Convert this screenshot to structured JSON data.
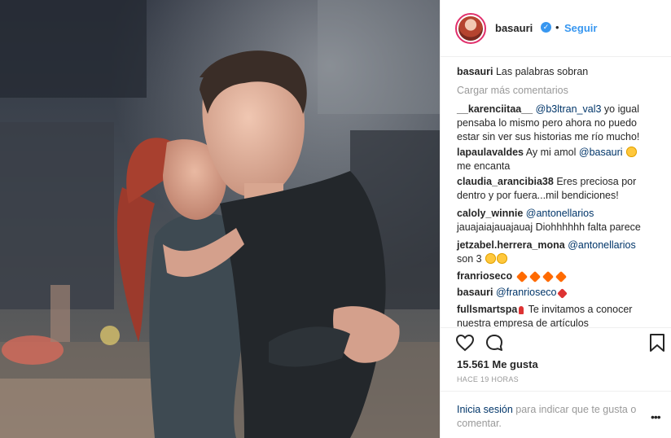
{
  "header": {
    "username": "basauri",
    "dot": "•",
    "follow_label": "Seguir",
    "avatar_icon": "profile-avatar",
    "verified_icon": "verified-badge-icon"
  },
  "caption": {
    "username": "basauri",
    "text": "Las palabras sobran"
  },
  "load_more": "Cargar más comentarios",
  "comments": [
    {
      "user": "__karenciitaa__",
      "mention": "@b3ltran_val3",
      "text": "yo igual pensaba lo mismo pero ahora no puedo estar sin ver sus historias me río mucho!"
    },
    {
      "user": "lapaulavaldes",
      "text_before": "Ay mi amol",
      "mention": "@basauri",
      "text_after": "me encanta",
      "emoji": "heart-eyes-emoji"
    },
    {
      "user": "claudia_arancibia38",
      "text": "Eres preciosa por dentro y por fuera...mil bendiciones!"
    },
    {
      "user": "caloly_winnie",
      "mention": "@antonellarios",
      "text": "jauajaiajauajauaj Diohhhhhh falta parece"
    },
    {
      "user": "jetzabel.herrera_mona",
      "mention": "@antonellarios",
      "text": "son 3",
      "emoji": "laughing-emoji"
    },
    {
      "user": "franrioseco",
      "emoji": "sparkle-emoji"
    },
    {
      "user": "basauri",
      "mention": "@franrioseco",
      "emoji": "heart-emoji"
    },
    {
      "user": "fullsmartspa",
      "text": "Te invitamos a conocer nuestra empresa de artículos Tecnológicos",
      "emoji": "pin-emoji"
    }
  ],
  "actions": {
    "like_icon": "heart-icon",
    "comment_icon": "comment-icon",
    "save_icon": "bookmark-icon"
  },
  "likes": "15.561 Me gusta",
  "time": "HACE 19 HORAS",
  "footer": {
    "login_link": "Inicia sesión",
    "login_text": "para indicar que te gusta o comentar.",
    "more_icon": "ellipsis-icon",
    "more_label": "•••"
  }
}
